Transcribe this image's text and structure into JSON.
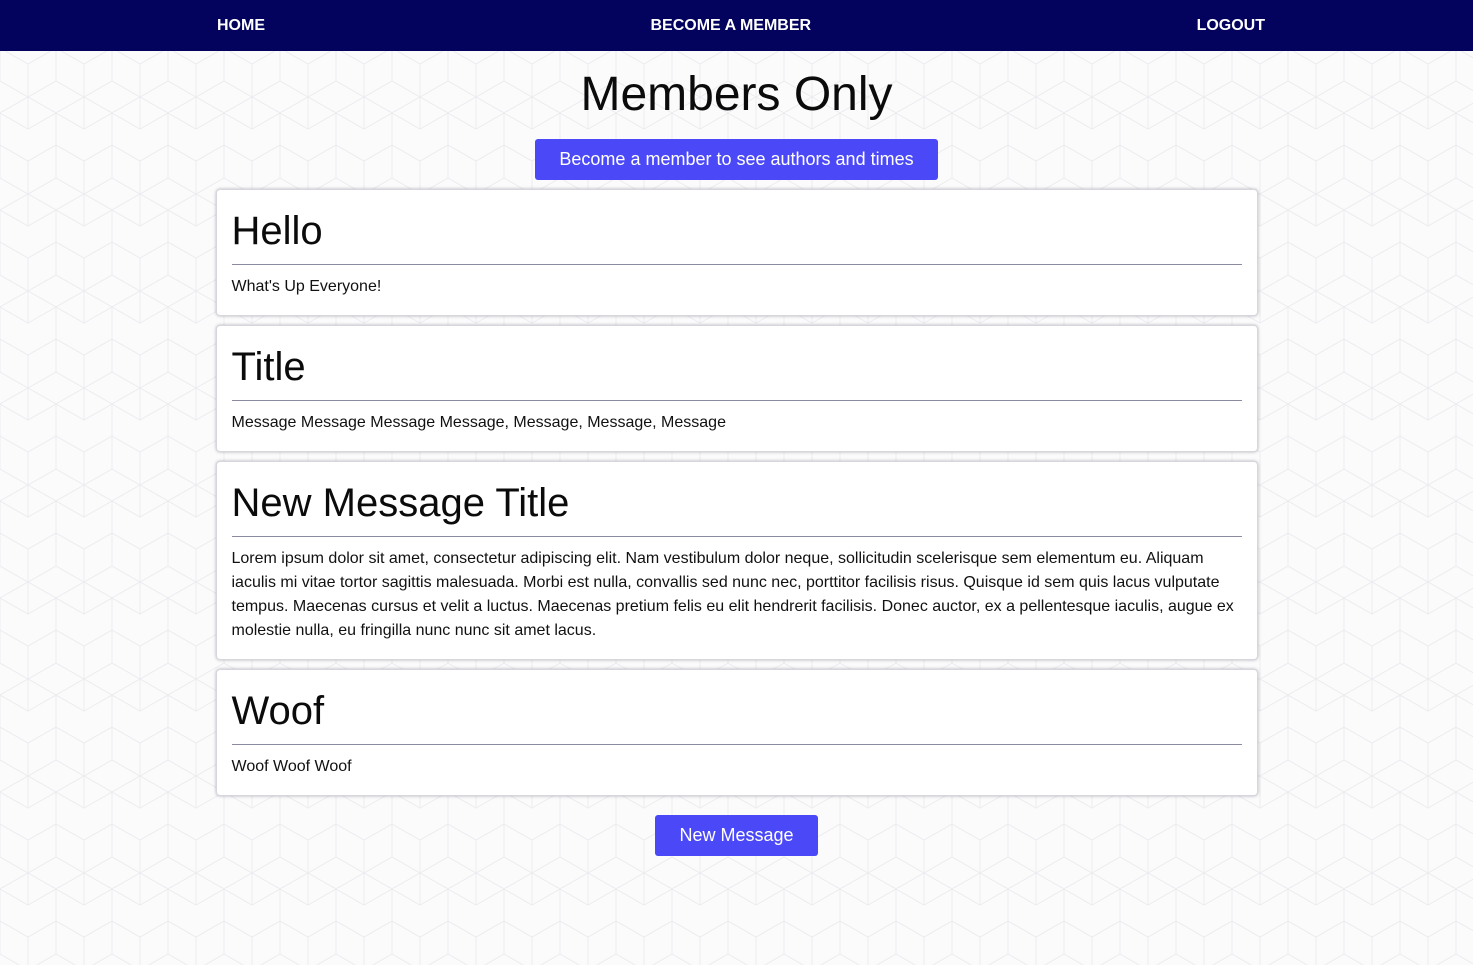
{
  "nav": {
    "home": "HOME",
    "become_member": "BECOME A MEMBER",
    "logout": "LOGOUT"
  },
  "page": {
    "title": "Members Only",
    "member_button": "Become a member to see authors and times",
    "new_message_button": "New Message"
  },
  "messages": [
    {
      "title": "Hello",
      "body": "What's Up Everyone!"
    },
    {
      "title": "Title",
      "body": "Message Message Message Message, Message, Message, Message"
    },
    {
      "title": "New Message Title",
      "body": "Lorem ipsum dolor sit amet, consectetur adipiscing elit. Nam vestibulum dolor neque, sollicitudin scelerisque sem elementum eu. Aliquam iaculis mi vitae tortor sagittis malesuada. Morbi est nulla, convallis sed nunc nec, porttitor facilisis risus. Quisque id sem quis lacus vulputate tempus. Maecenas cursus et velit a luctus. Maecenas pretium felis eu elit hendrerit facilisis. Donec auctor, ex a pellentesque iaculis, augue ex molestie nulla, eu fringilla nunc nunc sit amet lacus."
    },
    {
      "title": "Woof",
      "body": "Woof Woof Woof"
    }
  ],
  "colors": {
    "navbar": "#03035e",
    "button": "#4b49f7",
    "background": "#fbfbfc"
  }
}
